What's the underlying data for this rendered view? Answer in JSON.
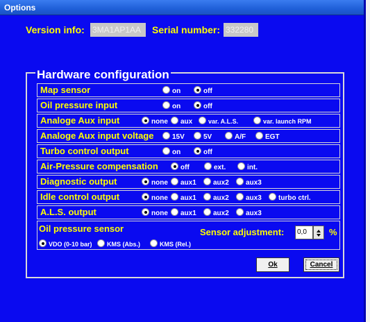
{
  "window": {
    "title": "Options"
  },
  "info": {
    "version_label": "Version info:",
    "version_value": "3MA1AP1AA",
    "serial_label": "Serial number:",
    "serial_value": "332280"
  },
  "hardware": {
    "title": "Hardware configuration",
    "rows": [
      {
        "label": "Map sensor",
        "options": [
          {
            "label": "on",
            "selected": false
          },
          {
            "label": "off",
            "selected": true
          }
        ]
      },
      {
        "label": "Oil pressure input",
        "options": [
          {
            "label": "on",
            "selected": false
          },
          {
            "label": "off",
            "selected": true
          }
        ]
      },
      {
        "label": "Analoge Aux input",
        "options": [
          {
            "label": "none",
            "selected": true
          },
          {
            "label": "aux",
            "selected": false
          },
          {
            "label": "var. A.L.S.",
            "selected": false
          },
          {
            "label": "var. launch RPM",
            "selected": false
          }
        ]
      },
      {
        "label": "Analoge Aux input voltage",
        "options": [
          {
            "label": "15V",
            "selected": false
          },
          {
            "label": "5V",
            "selected": false
          },
          {
            "label": "A/F",
            "selected": false
          },
          {
            "label": "EGT",
            "selected": false
          }
        ]
      },
      {
        "label": "Turbo control output",
        "options": [
          {
            "label": "on",
            "selected": false
          },
          {
            "label": "off",
            "selected": true
          }
        ]
      },
      {
        "label": "Air-Pressure compensation",
        "options": [
          {
            "label": "off",
            "selected": true
          },
          {
            "label": "ext.",
            "selected": false
          },
          {
            "label": "int.",
            "selected": false
          }
        ]
      },
      {
        "label": "Diagnostic output",
        "options": [
          {
            "label": "none",
            "selected": true
          },
          {
            "label": "aux1",
            "selected": false
          },
          {
            "label": "aux2",
            "selected": false
          },
          {
            "label": "aux3",
            "selected": false
          }
        ]
      },
      {
        "label": "Idle control output",
        "options": [
          {
            "label": "none",
            "selected": true
          },
          {
            "label": "aux1",
            "selected": false
          },
          {
            "label": "aux2",
            "selected": false
          },
          {
            "label": "aux3",
            "selected": false
          },
          {
            "label": "turbo ctrl.",
            "selected": false
          }
        ]
      },
      {
        "label": "A.L.S. output",
        "options": [
          {
            "label": "none",
            "selected": true
          },
          {
            "label": "aux1",
            "selected": false
          },
          {
            "label": "aux2",
            "selected": false
          },
          {
            "label": "aux3",
            "selected": false
          }
        ]
      }
    ]
  },
  "oil_sensor": {
    "title": "Oil pressure sensor",
    "options": [
      {
        "label": "VDO (0-10 bar)",
        "selected": true
      },
      {
        "label": "KMS (Abs.)",
        "selected": false
      },
      {
        "label": "KMS (Rel.)",
        "selected": false
      }
    ],
    "adjust_label": "Sensor adjustment:",
    "adjust_value": "0,0",
    "adjust_unit": "%"
  },
  "buttons": {
    "ok": "Ok",
    "cancel": "Cancel"
  },
  "colors": {
    "window_bg": "#0a0af0",
    "label_yellow": "#ffff00",
    "title_blue": "#1f5fd8"
  }
}
